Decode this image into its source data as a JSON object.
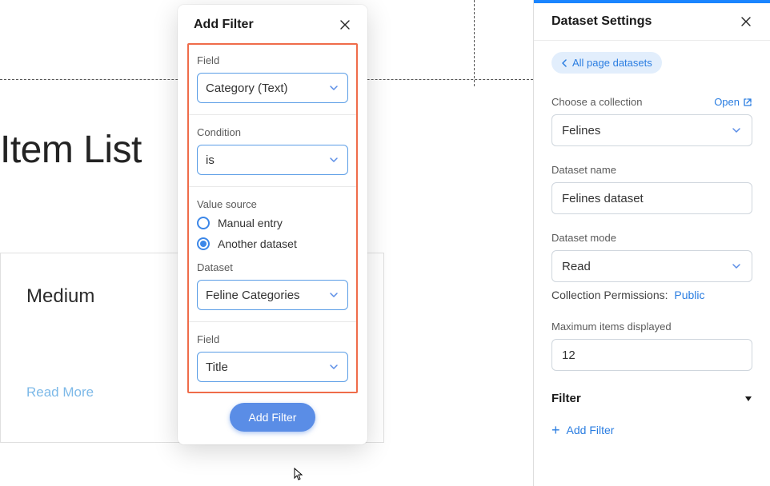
{
  "bg": {
    "title": "Item List",
    "card_title": "Medium",
    "read_more": "Read More"
  },
  "addFilter": {
    "title": "Add Filter",
    "field_label": "Field",
    "field_value": "Category (Text)",
    "condition_label": "Condition",
    "condition_value": "is",
    "value_source_label": "Value source",
    "radio_manual": "Manual entry",
    "radio_another": "Another dataset",
    "radio_selected": "another",
    "dataset_label": "Dataset",
    "dataset_value": "Feline Categories",
    "field2_label": "Field",
    "field2_value": "Title",
    "submit": "Add Filter"
  },
  "ds": {
    "title": "Dataset Settings",
    "back": "All page datasets",
    "collection_label": "Choose a collection",
    "open": "Open",
    "collection_value": "Felines",
    "name_label": "Dataset name",
    "name_value": "Felines dataset",
    "mode_label": "Dataset mode",
    "mode_value": "Read",
    "perm_label": "Collection Permissions:",
    "perm_value": "Public",
    "max_label": "Maximum items displayed",
    "max_value": "12",
    "filter_section": "Filter",
    "add_filter_link": "Add Filter"
  },
  "colors": {
    "accent": "#2a7de1",
    "highlight_border": "#ef6c4a"
  }
}
